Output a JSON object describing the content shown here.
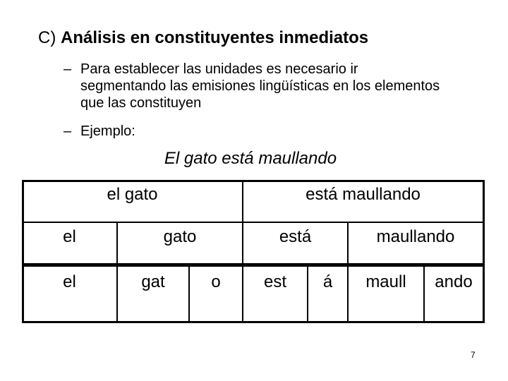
{
  "slide": {
    "title_prefix": "C)",
    "title_bold": "Análisis en constituyentes inmediatos",
    "bullets": [
      {
        "dash": "–",
        "text": "Para establecer las unidades es necesario ir segmentando las emisiones lingüísticas en los elementos que las constituyen"
      },
      {
        "dash": "–",
        "text": "Ejemplo:"
      }
    ],
    "example_sentence": "El gato está maullando",
    "page_number": "7"
  },
  "analysis_table": {
    "rows": [
      {
        "level": "phrases",
        "cells": [
          "el gato",
          "está maullando"
        ]
      },
      {
        "level": "words",
        "cells": [
          "el",
          "gato",
          "está",
          "maullando"
        ]
      },
      {
        "level": "morphemes",
        "cells": [
          "el",
          "gat",
          "o",
          "est",
          "á",
          "maull",
          "ando"
        ]
      }
    ]
  }
}
